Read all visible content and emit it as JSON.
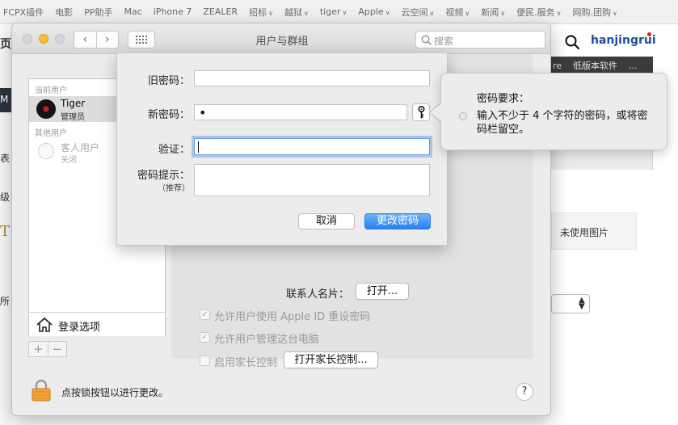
{
  "browser": {
    "bookmarks": [
      {
        "label": "FCPX插件",
        "dropdown": false
      },
      {
        "label": "电影",
        "dropdown": false
      },
      {
        "label": "PP助手",
        "dropdown": false
      },
      {
        "label": "Mac",
        "dropdown": false
      },
      {
        "label": "iPhone 7",
        "dropdown": false
      },
      {
        "label": "ZEALER",
        "dropdown": false
      },
      {
        "label": "招标",
        "dropdown": true
      },
      {
        "label": "越狱",
        "dropdown": true
      },
      {
        "label": "tiger",
        "dropdown": true
      },
      {
        "label": "Apple",
        "dropdown": true
      },
      {
        "label": "云空间",
        "dropdown": true
      },
      {
        "label": "视频",
        "dropdown": true
      },
      {
        "label": "新闻",
        "dropdown": true
      },
      {
        "label": "便民.服务",
        "dropdown": true
      },
      {
        "label": "网购.团购",
        "dropdown": true
      }
    ],
    "page": {
      "username": "hanjingrui",
      "nav_items": [
        "re",
        "低版本软件",
        "..."
      ],
      "unused_photo_label": "未使用图片",
      "left_fragments": [
        "页",
        "M",
        "表",
        "级",
        "T",
        "所"
      ]
    }
  },
  "window": {
    "title": "用户与群组",
    "search_placeholder": "搜索",
    "sidebar": {
      "current_users_header": "当前用户",
      "other_users_header": "其他用户",
      "users": [
        {
          "name": "Tiger",
          "role": "管理员",
          "selected": true
        },
        {
          "name": "客人用户",
          "role": "关闭",
          "selected": false
        }
      ],
      "login_options": "登录选项",
      "add": "+",
      "remove": "−"
    },
    "panel": {
      "contact_card_label": "联系人名片：",
      "open_button": "打开...",
      "options": [
        {
          "label": "允许用户使用 Apple ID 重设密码",
          "checked": true
        },
        {
          "label": "允许用户管理这台电脑",
          "checked": true
        },
        {
          "label": "启用家长控制",
          "checked": false
        }
      ],
      "parental_button": "打开家长控制..."
    },
    "lock_text": "点按锁按钮以进行更改。",
    "help": "?"
  },
  "sheet": {
    "old_password_label": "旧密码：",
    "old_password_value": "",
    "new_password_label": "新密码：",
    "new_password_value": "•",
    "verify_label": "验证：",
    "verify_value": "",
    "hint_label": "密码提示：",
    "hint_sub": "（推荐）",
    "hint_value": "",
    "cancel_button": "取消",
    "change_button": "更改密码"
  },
  "popover": {
    "title": "密码要求：",
    "requirement": "输入不少于 4 个字符的密码，或将密码栏留空。"
  },
  "colors": {
    "accent_blue": "#2a7ff0",
    "username_blue": "#1b4f9c",
    "notification_red": "#e02020",
    "minimize_yellow": "#fbbd2e"
  }
}
